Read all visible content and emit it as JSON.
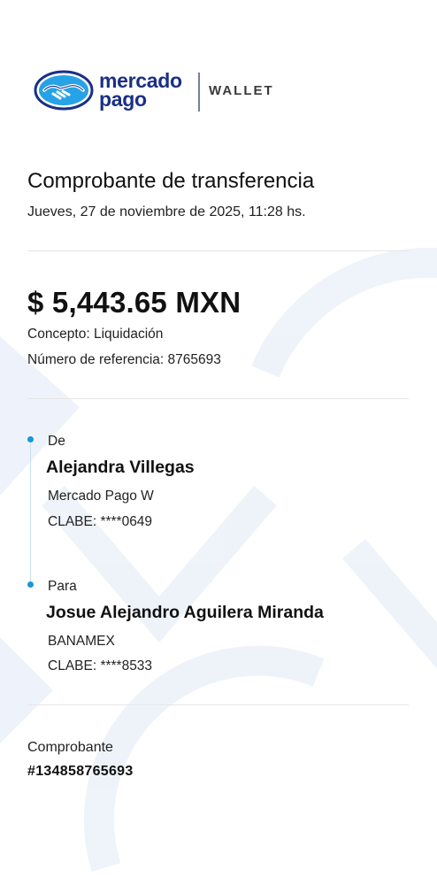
{
  "brand": {
    "line1": "mercado",
    "line2": "pago",
    "product": "WALLET",
    "primary_color": "#1a2f86",
    "logo_fill_color": "#26a3e6"
  },
  "receipt": {
    "title": "Comprobante de transferencia",
    "date": "Jueves, 27 de noviembre de 2025, 11:28 hs.",
    "amount": "$ 5,443.65 MXN",
    "concept_label": "Concepto:",
    "concept_value": "Liquidación",
    "reference_label": "Número de referencia:",
    "reference_value": "8765693"
  },
  "sender": {
    "label": "De",
    "name": "Alejandra Villegas",
    "bank": "Mercado Pago W",
    "clabe": "CLABE: ****0649"
  },
  "recipient": {
    "label": "Para",
    "name": "Josue Alejandro Aguilera Miranda",
    "bank": "BANAMEX",
    "clabe": "CLABE: ****8533"
  },
  "voucher": {
    "label": "Comprobante",
    "number": "#134858765693"
  },
  "colors": {
    "timeline_dot": "#1a96d9",
    "timeline_line": "#c8dff2",
    "watermark": "#eef3fb"
  },
  "icons": {
    "logo": "handshake-logo-icon"
  }
}
